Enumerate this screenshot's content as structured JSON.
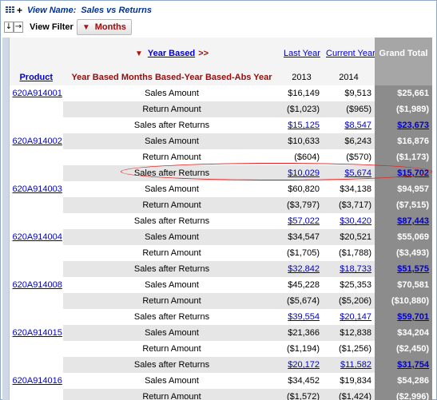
{
  "view": {
    "label": "View Name:",
    "name": "Sales vs Returns"
  },
  "filter": {
    "label": "View Filter",
    "chip": "Months"
  },
  "header": {
    "year_based": "Year Based",
    "more": ">>",
    "last_year": "Last Year",
    "current_year": "Current Year",
    "grand_total": "Grand Total",
    "product": "Product",
    "metric": "Year Based Months Based-Year Based-Abs Year",
    "y1": "2013",
    "y2": "2014"
  },
  "rows": [
    {
      "product": "620A914001",
      "metric": "Sales Amount",
      "v1": "$16,149",
      "v2": "$9,513",
      "gt": "$25,661",
      "link": false
    },
    {
      "product": "",
      "metric": "Return Amount",
      "v1": "($1,023)",
      "v2": "($965)",
      "gt": "($1,989)",
      "link": false
    },
    {
      "product": "",
      "metric": "Sales after Returns",
      "v1": "$15,125",
      "v2": "$8,547",
      "gt": "$23,673",
      "link": true
    },
    {
      "product": "620A914002",
      "metric": "Sales Amount",
      "v1": "$10,633",
      "v2": "$6,243",
      "gt": "$16,876",
      "link": false
    },
    {
      "product": "",
      "metric": "Return Amount",
      "v1": "($604)",
      "v2": "($570)",
      "gt": "($1,173)",
      "link": false
    },
    {
      "product": "",
      "metric": "Sales after Returns",
      "v1": "$10,029",
      "v2": "$5,674",
      "gt": "$15,702",
      "link": true
    },
    {
      "product": "620A914003",
      "metric": "Sales Amount",
      "v1": "$60,820",
      "v2": "$34,138",
      "gt": "$94,957",
      "link": false
    },
    {
      "product": "",
      "metric": "Return Amount",
      "v1": "($3,797)",
      "v2": "($3,717)",
      "gt": "($7,515)",
      "link": false
    },
    {
      "product": "",
      "metric": "Sales after Returns",
      "v1": "$57,022",
      "v2": "$30,420",
      "gt": "$87,443",
      "link": true
    },
    {
      "product": "620A914004",
      "metric": "Sales Amount",
      "v1": "$34,547",
      "v2": "$20,521",
      "gt": "$55,069",
      "link": false
    },
    {
      "product": "",
      "metric": "Return Amount",
      "v1": "($1,705)",
      "v2": "($1,788)",
      "gt": "($3,493)",
      "link": false
    },
    {
      "product": "",
      "metric": "Sales after Returns",
      "v1": "$32,842",
      "v2": "$18,733",
      "gt": "$51,575",
      "link": true
    },
    {
      "product": "620A914008",
      "metric": "Sales Amount",
      "v1": "$45,228",
      "v2": "$25,353",
      "gt": "$70,581",
      "link": false
    },
    {
      "product": "",
      "metric": "Return Amount",
      "v1": "($5,674)",
      "v2": "($5,206)",
      "gt": "($10,880)",
      "link": false
    },
    {
      "product": "",
      "metric": "Sales after Returns",
      "v1": "$39,554",
      "v2": "$20,147",
      "gt": "$59,701",
      "link": true
    },
    {
      "product": "620A914015",
      "metric": "Sales Amount",
      "v1": "$21,366",
      "v2": "$12,838",
      "gt": "$34,204",
      "link": false
    },
    {
      "product": "",
      "metric": "Return Amount",
      "v1": "($1,194)",
      "v2": "($1,256)",
      "gt": "($2,450)",
      "link": false
    },
    {
      "product": "",
      "metric": "Sales after Returns",
      "v1": "$20,172",
      "v2": "$11,582",
      "gt": "$31,754",
      "link": true
    },
    {
      "product": "620A914016",
      "metric": "Sales Amount",
      "v1": "$34,452",
      "v2": "$19,834",
      "gt": "$54,286",
      "link": false
    },
    {
      "product": "",
      "metric": "Return Amount",
      "v1": "($1,572)",
      "v2": "($1,424)",
      "gt": "($2,996)",
      "link": false
    }
  ]
}
